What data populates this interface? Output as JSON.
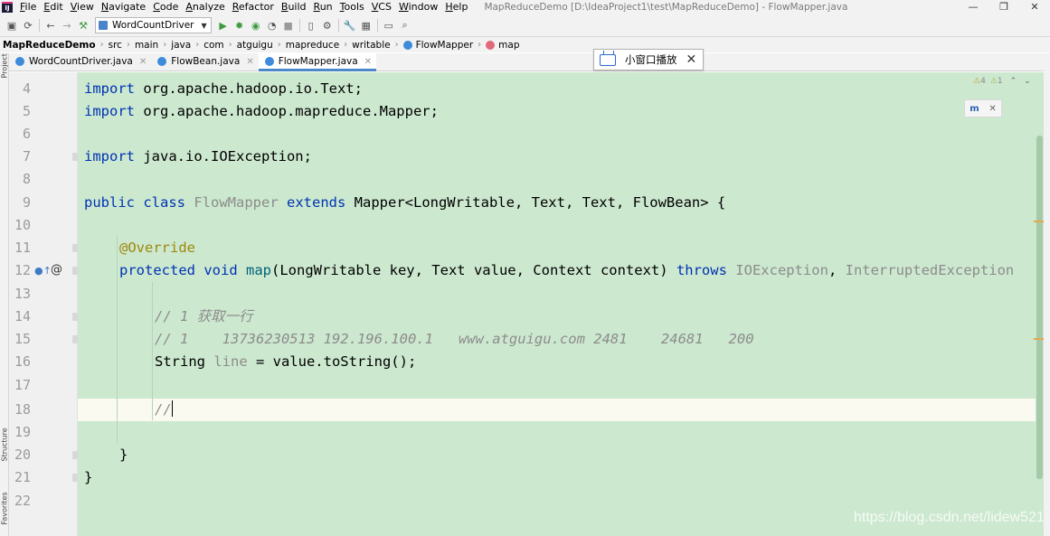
{
  "window": {
    "title": "MapReduceDemo [D:\\IdeaProject1\\test\\MapReduceDemo] - FlowMapper.java",
    "controls": [
      "—",
      "❐",
      "✕"
    ]
  },
  "menu": [
    "File",
    "Edit",
    "View",
    "Navigate",
    "Code",
    "Analyze",
    "Refactor",
    "Build",
    "Run",
    "Tools",
    "VCS",
    "Window",
    "Help"
  ],
  "toolbar": {
    "run_config": "WordCountDriver"
  },
  "breadcrumb": [
    "MapReduceDemo",
    "src",
    "main",
    "java",
    "com",
    "atguigu",
    "mapreduce",
    "writable",
    "FlowMapper",
    "map"
  ],
  "tabs": [
    {
      "label": "WordCountDriver.java",
      "active": false
    },
    {
      "label": "FlowBean.java",
      "active": false
    },
    {
      "label": "FlowMapper.java",
      "active": true
    }
  ],
  "mini_window": {
    "label": "小窗口播放"
  },
  "side_tools": {
    "top": "Project",
    "mid": "Structure",
    "bottom": "Favorites"
  },
  "inspections": {
    "warnings": "4",
    "weak_warnings": "1"
  },
  "editor": {
    "current_line": 18,
    "line_numbers": [
      "4",
      "5",
      "6",
      "7",
      "8",
      "9",
      "10",
      "11",
      "12",
      "13",
      "14",
      "15",
      "16",
      "17",
      "18",
      "19",
      "20",
      "21",
      "22"
    ],
    "code": {
      "l4_kw": "import",
      "l4_rest": " org.apache.hadoop.io.Text;",
      "l5_kw": "import",
      "l5_rest": " org.apache.hadoop.mapreduce.Mapper;",
      "l7_kw": "import",
      "l7_rest": " java.io.IOException;",
      "l9_kw1": "public class",
      "l9_cls": "FlowMapper",
      "l9_kw2": "extends",
      "l9_rest": " Mapper<LongWritable, Text, Text, FlowBean> {",
      "l11_ann": "@Override",
      "l12_kw": "protected void",
      "l12_fn": "map",
      "l12_params": "(LongWritable key, Text value, Context context) ",
      "l12_throws": "throws",
      "l12_ex1": "IOException",
      "l12_comma": ", ",
      "l12_ex2": "InterruptedException",
      "l14_cm": "// 1 获取一行",
      "l15_cm": "// 1    13736230513 192.196.100.1   www.atguigu.com 2481    24681   200",
      "l16_type": "String ",
      "l16_var": "line",
      "l16_rest": " = value.toString();",
      "l18_cm": "//",
      "l20": "}",
      "l21": "}"
    }
  },
  "watermark": "https://blog.csdn.net/lidew521"
}
